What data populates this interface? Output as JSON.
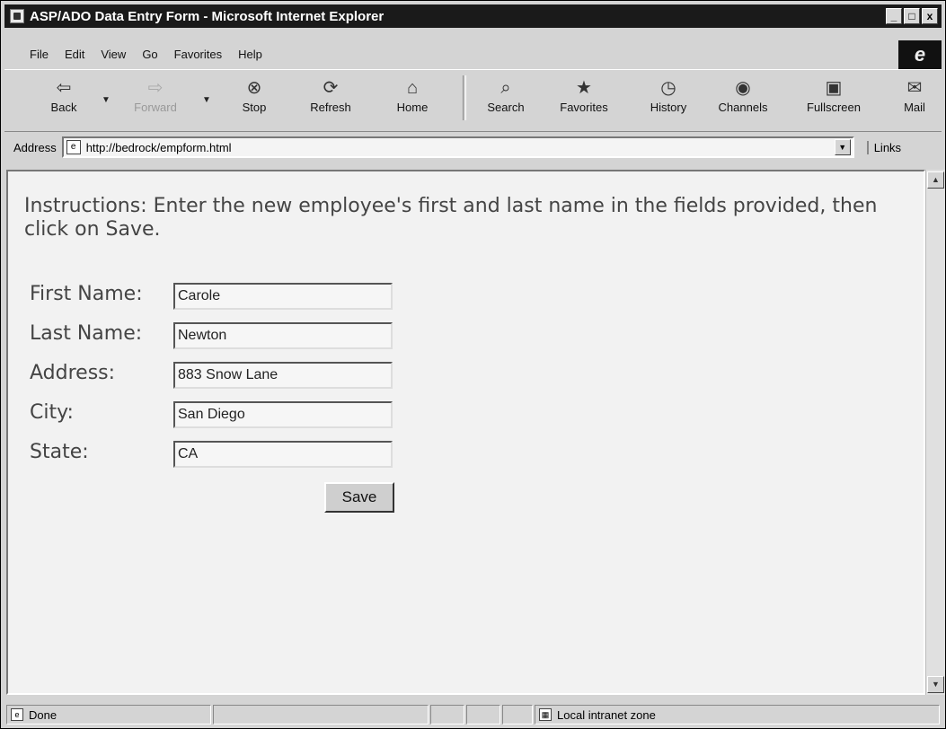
{
  "window": {
    "title": "ASP/ADO Data Entry Form - Microsoft Internet Explorer",
    "controls": [
      "_",
      "□",
      "x"
    ]
  },
  "menu": {
    "items": [
      "File",
      "Edit",
      "View",
      "Go",
      "Favorites",
      "Help"
    ],
    "logo": "e"
  },
  "toolbar": {
    "back": "Back",
    "forward": "Forward",
    "stop": "Stop",
    "refresh": "Refresh",
    "home": "Home",
    "search": "Search",
    "favorites": "Favorites",
    "history": "History",
    "channels": "Channels",
    "fullscreen": "Fullscreen",
    "mail": "Mail",
    "icons": {
      "back": "⇦",
      "forward": "⇨",
      "stop": "⊗",
      "refresh": "⟳",
      "home": "⌂",
      "search": "⌕",
      "favorites": "★",
      "history": "◷",
      "channels": "◉",
      "fullscreen": "▣",
      "mail": "✉"
    }
  },
  "address": {
    "label": "Address",
    "url": "http://bedrock/empform.html",
    "links": "Links"
  },
  "page": {
    "instructions": "Instructions: Enter the new employee's first and last name in the fields provided, then click on Save.",
    "fields": [
      {
        "label": "First Name:",
        "value": "Carole"
      },
      {
        "label": "Last Name:",
        "value": "Newton"
      },
      {
        "label": "Address:",
        "value": "883 Snow Lane"
      },
      {
        "label": "City:",
        "value": "San Diego"
      },
      {
        "label": "State:",
        "value": "CA"
      }
    ],
    "save_label": "Save"
  },
  "status": {
    "text": "Done",
    "zone": "Local intranet zone"
  }
}
